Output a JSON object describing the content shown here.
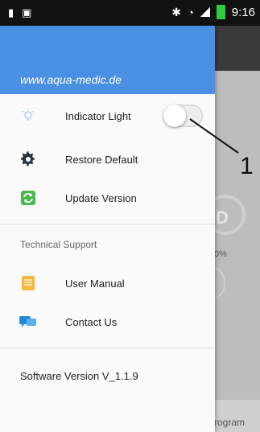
{
  "status_bar": {
    "time": "9:16",
    "icons": [
      "sim-icon",
      "image-icon",
      "bluetooth-icon",
      "wifi-icon",
      "signal-icon",
      "battery-icon"
    ],
    "battery_color": "#2ecc40"
  },
  "drawer": {
    "header": {
      "link": "www.aqua-medic.de",
      "color": "#4a90e2"
    },
    "items": [
      {
        "label": "Indicator Light",
        "icon": "lightbulb-icon"
      },
      {
        "label": "Restore Default",
        "icon": "gear-icon"
      },
      {
        "label": "Update Version",
        "icon": "refresh-icon"
      }
    ],
    "section_title": "Technical Support",
    "support_items": [
      {
        "label": "User Manual",
        "icon": "book-icon"
      },
      {
        "label": "Contact Us",
        "icon": "chat-icon"
      }
    ],
    "software_version": "Software Version V_1.1.9",
    "toggle_on": false
  },
  "background": {
    "circle_text": "D",
    "percent_text": "0%",
    "footer_text": "rogram"
  },
  "callout": {
    "number": "1"
  }
}
